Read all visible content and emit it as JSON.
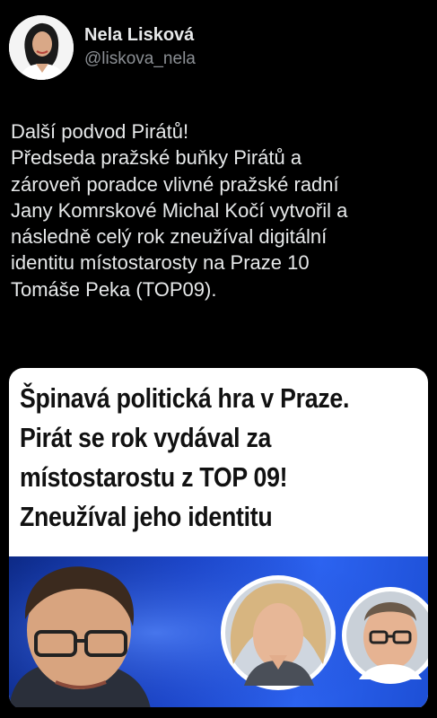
{
  "author": {
    "name": "Nela Lisková",
    "handle": "@liskova_nela"
  },
  "tweet": {
    "lines": [
      "Další podvod Pirátů!",
      "Předseda pražské buňky Pirátů a",
      "zároveň poradce vlivné pražské radní",
      "Jany Komrskové Michal Kočí vytvořil a",
      "následně celý rok zneužíval digitální",
      "identitu místostarosty na Praze 10",
      "Tomáše Peka (TOP09)."
    ]
  },
  "card": {
    "headline": [
      "Špinavá politická hra v Praze.",
      "Pirát se rok vydával za",
      "místostarostu z TOP 09!",
      "Zneužíval jeho identitu"
    ]
  }
}
